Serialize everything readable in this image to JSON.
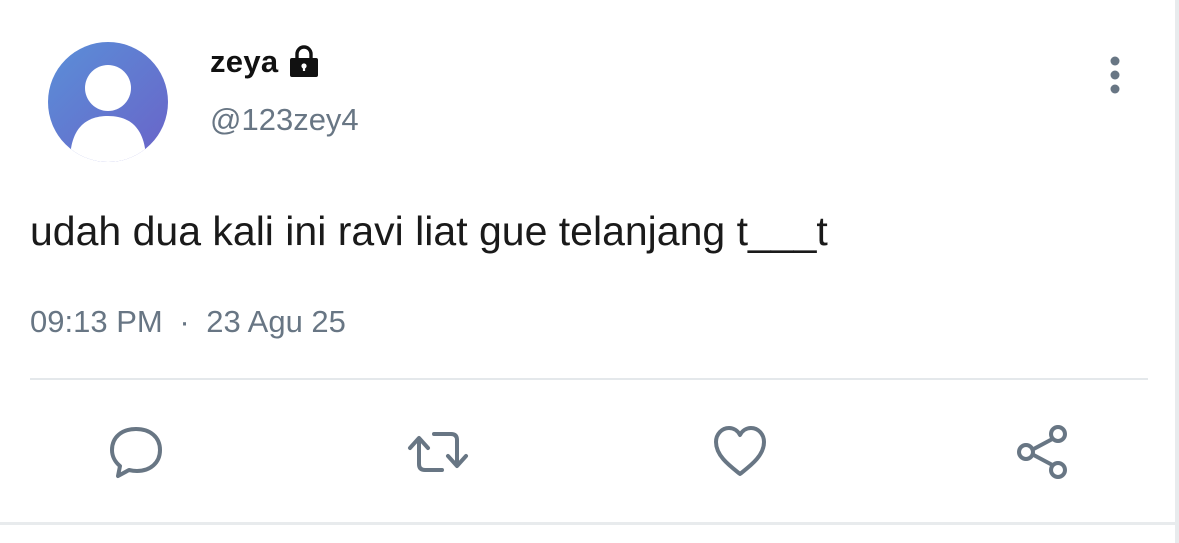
{
  "user": {
    "display_name": "zeya",
    "username": "@123zey4",
    "protected_icon": "lock-icon",
    "avatar": "default-avatar"
  },
  "tweet": {
    "text": "udah dua kali ini ravi liat gue telanjang t___t",
    "time": "09:13 PM",
    "separator": "·",
    "date": "23 Agu 25"
  },
  "actions": [
    {
      "name": "reply",
      "icon": "speech-bubble-icon"
    },
    {
      "name": "retweet",
      "icon": "retweet-icon"
    },
    {
      "name": "like",
      "icon": "heart-icon"
    },
    {
      "name": "share",
      "icon": "share-icon"
    }
  ],
  "menu": {
    "icon": "vertical-dots-icon"
  },
  "colors": {
    "text_primary": "#111111",
    "text_secondary": "#687684",
    "icon": "#687684",
    "divider": "#e4e8eb",
    "avatar_gradient_start": "#5a8fd8",
    "avatar_gradient_end": "#6a63c8"
  }
}
